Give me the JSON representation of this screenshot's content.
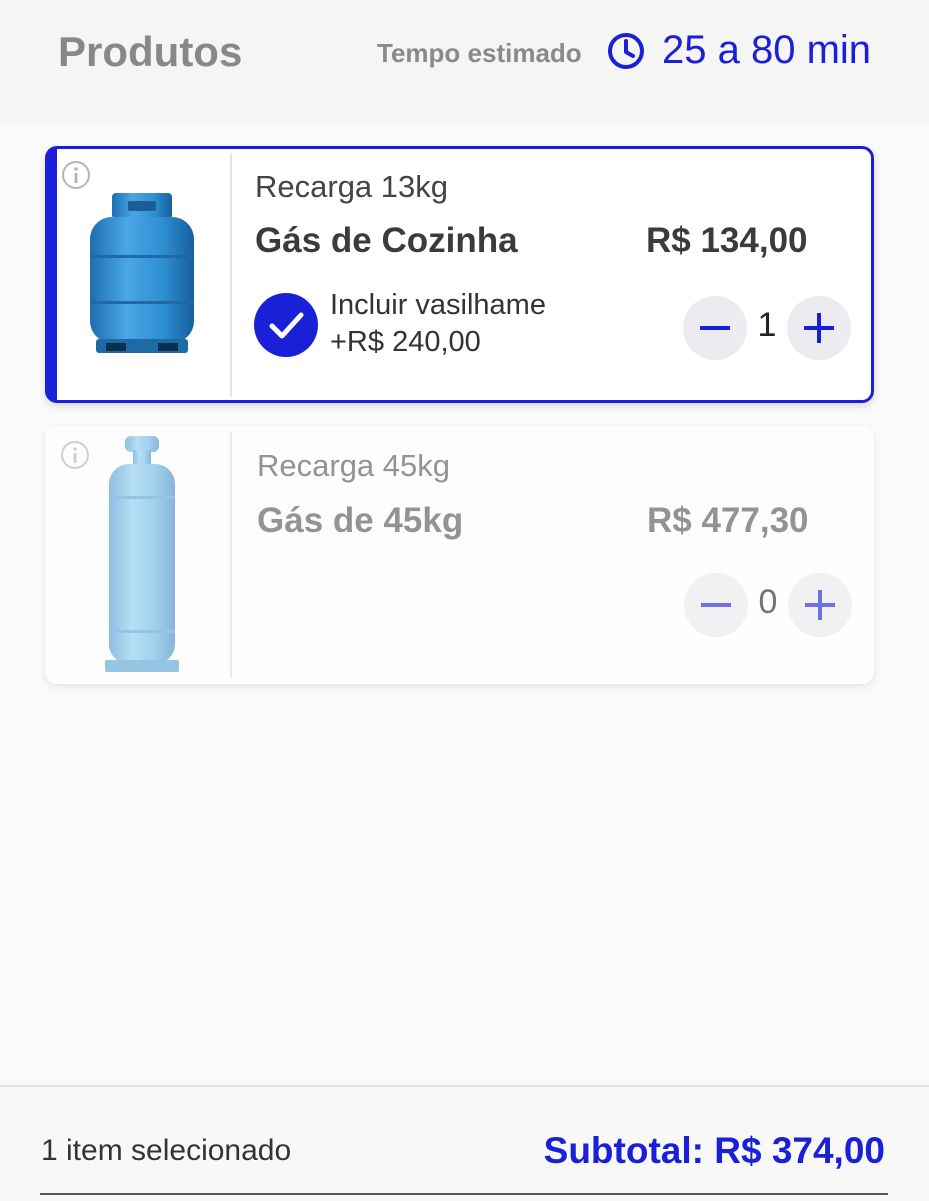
{
  "header": {
    "title": "Produtos",
    "eta_label": "Tempo estimado",
    "eta_value": "25 a 80 min",
    "icon": "clock-icon"
  },
  "products": [
    {
      "subtitle": "Recarga 13kg",
      "name": "Gás de Cozinha",
      "price": "R$ 134,00",
      "quantity": "1",
      "selected": true,
      "container_option": {
        "checked": true,
        "label": "Incluir vasilhame",
        "price": "+R$ 240,00"
      }
    },
    {
      "subtitle": "Recarga 45kg",
      "name": "Gás de 45kg",
      "price": "R$ 477,30",
      "quantity": "0",
      "selected": false
    }
  ],
  "footer": {
    "selected_count": "1 item selecionado",
    "subtotal": "Subtotal: R$ 374,00"
  },
  "colors": {
    "accent": "#1a20d8",
    "cylinder_13kg": "#2e8fd3",
    "cylinder_45kg": "#6cb8e8"
  }
}
